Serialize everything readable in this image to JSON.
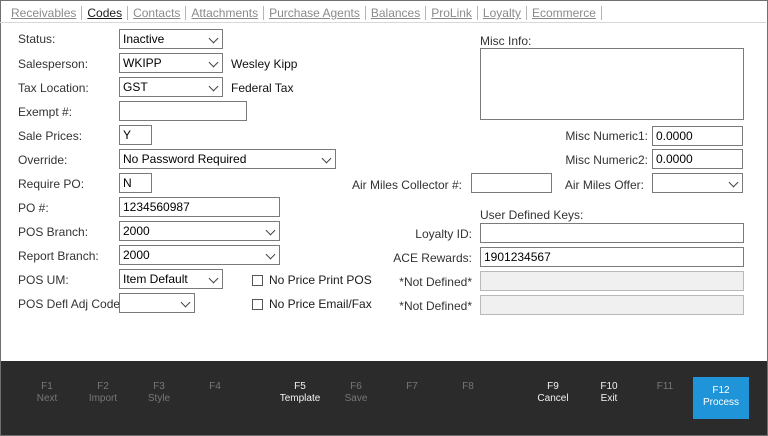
{
  "tabs": [
    {
      "label": "Receivables",
      "active": false
    },
    {
      "label": "Codes",
      "active": true
    },
    {
      "label": "Contacts",
      "active": false
    },
    {
      "label": "Attachments",
      "active": false
    },
    {
      "label": "Purchase Agents",
      "active": false
    },
    {
      "label": "Balances",
      "active": false
    },
    {
      "label": "ProLink",
      "active": false
    },
    {
      "label": "Loyalty",
      "active": false
    },
    {
      "label": "Ecommerce",
      "active": false
    }
  ],
  "form": {
    "status": {
      "label": "Status:",
      "value": "Inactive"
    },
    "salesperson": {
      "label": "Salesperson:",
      "value": "WKIPP",
      "name": "Wesley Kipp"
    },
    "tax_location": {
      "label": "Tax Location:",
      "value": "GST",
      "desc": "Federal Tax"
    },
    "exempt": {
      "label": "Exempt #:",
      "value": ""
    },
    "sale_prices": {
      "label": "Sale Prices:",
      "value": "Y"
    },
    "override": {
      "label": "Override:",
      "value": "No Password Required"
    },
    "require_po": {
      "label": "Require PO:",
      "value": "N"
    },
    "po_number": {
      "label": "PO #:",
      "value": "1234560987"
    },
    "pos_branch": {
      "label": "POS Branch:",
      "value": "2000"
    },
    "report_branch": {
      "label": "Report Branch:",
      "value": "2000"
    },
    "pos_um": {
      "label": "POS UM:",
      "value": "Item Default"
    },
    "pos_defl_adj": {
      "label": "POS Defl Adj Code:",
      "value": ""
    },
    "no_price_print_pos": {
      "label": "No Price Print POS",
      "checked": false
    },
    "no_price_email_fax": {
      "label": "No Price Email/Fax",
      "checked": false
    },
    "misc_info": {
      "label": "Misc Info:",
      "value": ""
    },
    "misc_numeric1": {
      "label": "Misc Numeric1:",
      "value": "0.0000"
    },
    "misc_numeric2": {
      "label": "Misc Numeric2:",
      "value": "0.0000"
    },
    "air_miles_collector": {
      "label": "Air Miles Collector #:",
      "value": ""
    },
    "air_miles_offer": {
      "label": "Air Miles Offer:",
      "value": ""
    },
    "user_defined_keys": {
      "label": "User Defined Keys:"
    },
    "loyalty_id": {
      "label": "Loyalty ID:",
      "value": ""
    },
    "ace_rewards": {
      "label": "ACE Rewards:",
      "value": "1901234567"
    },
    "not_defined_1": {
      "label": "*Not Defined*",
      "value": ""
    },
    "not_defined_2": {
      "label": "*Not Defined*",
      "value": ""
    }
  },
  "function_keys": [
    {
      "key": "F1",
      "action": "Next",
      "enabled": false
    },
    {
      "key": "F2",
      "action": "Import",
      "enabled": false
    },
    {
      "key": "F3",
      "action": "Style",
      "enabled": false
    },
    {
      "key": "F4",
      "action": "",
      "enabled": false
    },
    {
      "key": "F5",
      "action": "Template",
      "enabled": true
    },
    {
      "key": "F6",
      "action": "Save",
      "enabled": false
    },
    {
      "key": "F7",
      "action": "",
      "enabled": false
    },
    {
      "key": "F8",
      "action": "",
      "enabled": false
    },
    {
      "key": "F9",
      "action": "Cancel",
      "enabled": true
    },
    {
      "key": "F10",
      "action": "Exit",
      "enabled": true
    },
    {
      "key": "F11",
      "action": "",
      "enabled": false
    },
    {
      "key": "F12",
      "action": "Process",
      "enabled": true
    }
  ],
  "colors": {
    "accent": "#1f94d8",
    "footer_bg": "#2b2b2b"
  }
}
